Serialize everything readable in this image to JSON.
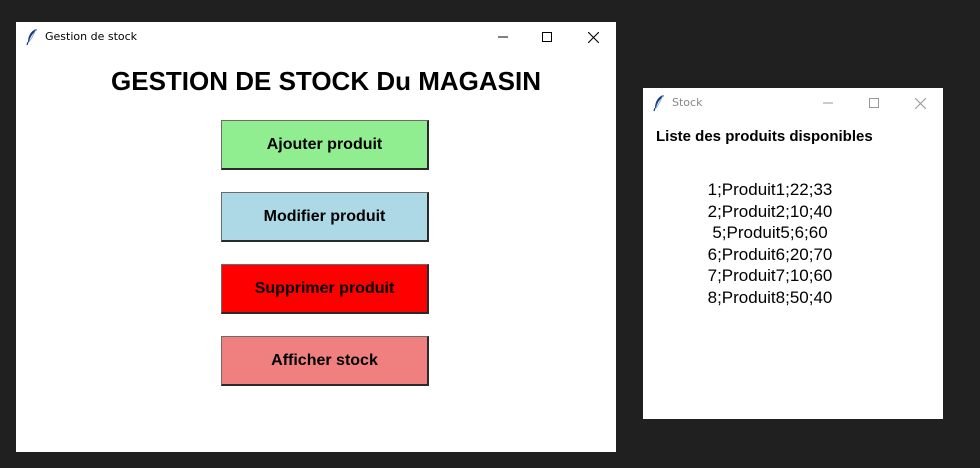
{
  "main_window": {
    "title": "Gestion de stock",
    "heading": "GESTION DE STOCK Du MAGASIN",
    "buttons": {
      "add": {
        "label": "Ajouter produit",
        "color": "#90ee90"
      },
      "edit": {
        "label": "Modifier produit",
        "color": "#add8e6"
      },
      "delete": {
        "label": "Supprimer produit",
        "color": "#ff0000"
      },
      "show": {
        "label": "Afficher stock",
        "color": "#f08080"
      }
    },
    "controls": [
      "minimize-icon",
      "maximize-icon",
      "close-icon"
    ]
  },
  "stock_window": {
    "title": "Stock",
    "heading": "Liste des produits disponibles",
    "items": [
      "1;Produit1;22;33",
      "2;Produit2;10;40",
      "5;Produit5;6;60",
      "6;Produit6;20;70",
      "7;Produit7;10;60",
      "8;Produit8;50;40"
    ],
    "controls": [
      "minimize-icon",
      "maximize-icon",
      "close-icon"
    ]
  },
  "colors": {
    "desktop_background": "#202020",
    "window_background": "#ffffff"
  }
}
